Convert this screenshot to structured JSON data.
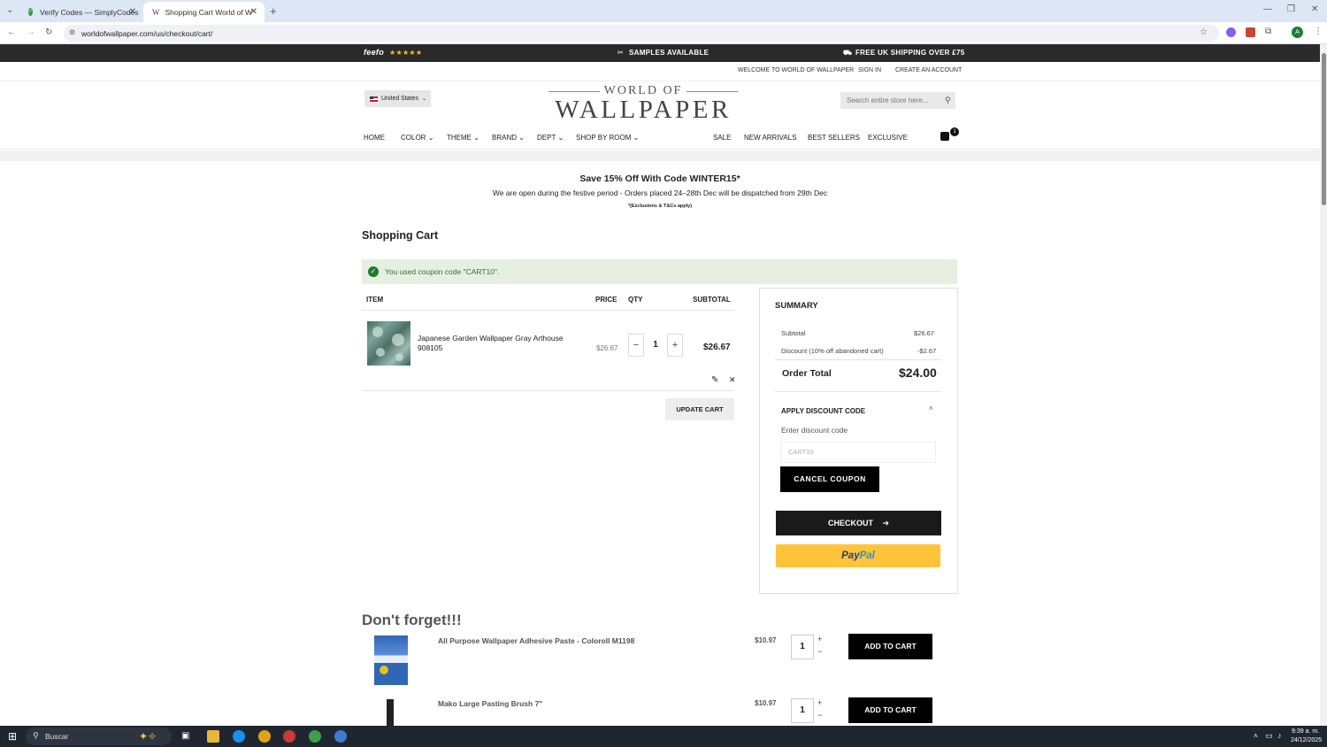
{
  "browser": {
    "tabs": [
      {
        "title": "Verify Codes — SimplyCodes",
        "active": false
      },
      {
        "title": "Shopping Cart World of Wallpaper",
        "active": true
      }
    ],
    "url": "worldofwallpaper.com/us/checkout/cart/",
    "profile_initial": "A"
  },
  "site": {
    "topbar": {
      "rating_brand": "feefo",
      "stars": "★★★★★",
      "samples": "SAMPLES AVAILABLE",
      "shipping": "FREE UK SHIPPING OVER £75"
    },
    "account": {
      "welcome": "WELCOME TO WORLD OF WALLPAPER",
      "sign_in": "SIGN IN",
      "create": "CREATE AN ACCOUNT"
    },
    "country": "United States",
    "logo_top": "WORLD OF",
    "logo_bottom": "WALLPAPER",
    "search_placeholder": "Search entire store here...",
    "nav": {
      "home": "HOME",
      "color": "COLOR",
      "theme": "THEME",
      "brand": "BRAND",
      "dept": "DEPT",
      "room": "SHOP BY ROOM",
      "sale": "SALE",
      "new": "NEW ARRIVALS",
      "best": "BEST SELLERS",
      "exclusive": "EXCLUSIVE"
    },
    "cart_count": "1"
  },
  "promo": {
    "headline": "Save 15% Off With Code WINTER15*",
    "notice": "We are open during the festive period - Orders placed 24–28th Dec will be dispatched from 29th Dec",
    "terms": "*(Exclusions & T&Cs apply)"
  },
  "cart": {
    "title": "Shopping Cart",
    "message": "You used coupon code \"CART10\".",
    "headers": {
      "item": "ITEM",
      "price": "PRICE",
      "qty": "QTY",
      "subtotal": "SUBTOTAL"
    },
    "item": {
      "name": "Japanese Garden Wallpaper Gray Arthouse 908105",
      "price": "$26.67",
      "qty": "1",
      "subtotal": "$26.67"
    },
    "update_label": "UPDATE CART"
  },
  "summary": {
    "title": "SUMMARY",
    "subtotal_label": "Subtotal",
    "subtotal_value": "$26.67",
    "discount_label": "Discount (10% off abandoned cart)",
    "discount_value": "-$2.67",
    "order_total_label": "Order Total",
    "order_total_value": "$24.00",
    "discount_section": "APPLY DISCOUNT CODE",
    "discount_field_label": "Enter discount code",
    "discount_code": "CART10",
    "cancel_coupon": "CANCEL COUPON",
    "checkout": "CHECKOUT",
    "paypal_a": "Pay",
    "paypal_b": "Pal"
  },
  "upsell": {
    "title": "Don't forget!!!",
    "items": [
      {
        "name": "All Purpose Wallpaper Adhesive Paste - Coloroll M1198",
        "price": "$10.97",
        "qty": "1",
        "button": "ADD TO CART"
      },
      {
        "name": "Mako Large Pasting Brush 7\"",
        "price": "$10.97",
        "qty": "1",
        "button": "ADD TO CART"
      }
    ]
  },
  "taskbar": {
    "search": "Buscar",
    "time": "9:39 a. m.",
    "date": "24/12/2025"
  }
}
